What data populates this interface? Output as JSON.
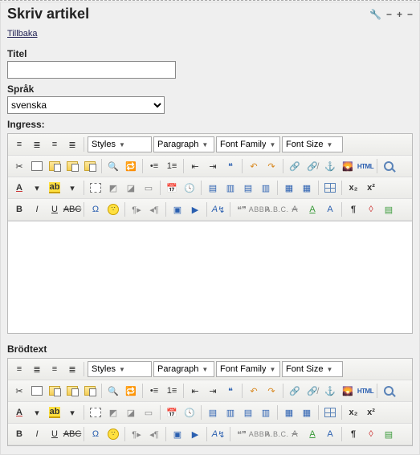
{
  "header": {
    "title": "Skriv artikel"
  },
  "nav": {
    "back": "Tillbaka"
  },
  "fields": {
    "title_label": "Titel",
    "title_value": "",
    "lang_label": "Språk",
    "lang_value": "svenska",
    "ingress_label": "Ingress:",
    "body_label": "Brödtext"
  },
  "toolbar": {
    "styles": "Styles",
    "paragraph": "Paragraph",
    "font_family": "Font Family",
    "font_size": "Font Size",
    "html": "HTML",
    "abc": "ABC",
    "abbr": "ABBR",
    "a_b_c": "A.B.C."
  },
  "icons": {
    "wrench": "wrench-icon",
    "minus": "minimize-icon",
    "plus": "expand-icon",
    "dash": "collapse-icon"
  }
}
